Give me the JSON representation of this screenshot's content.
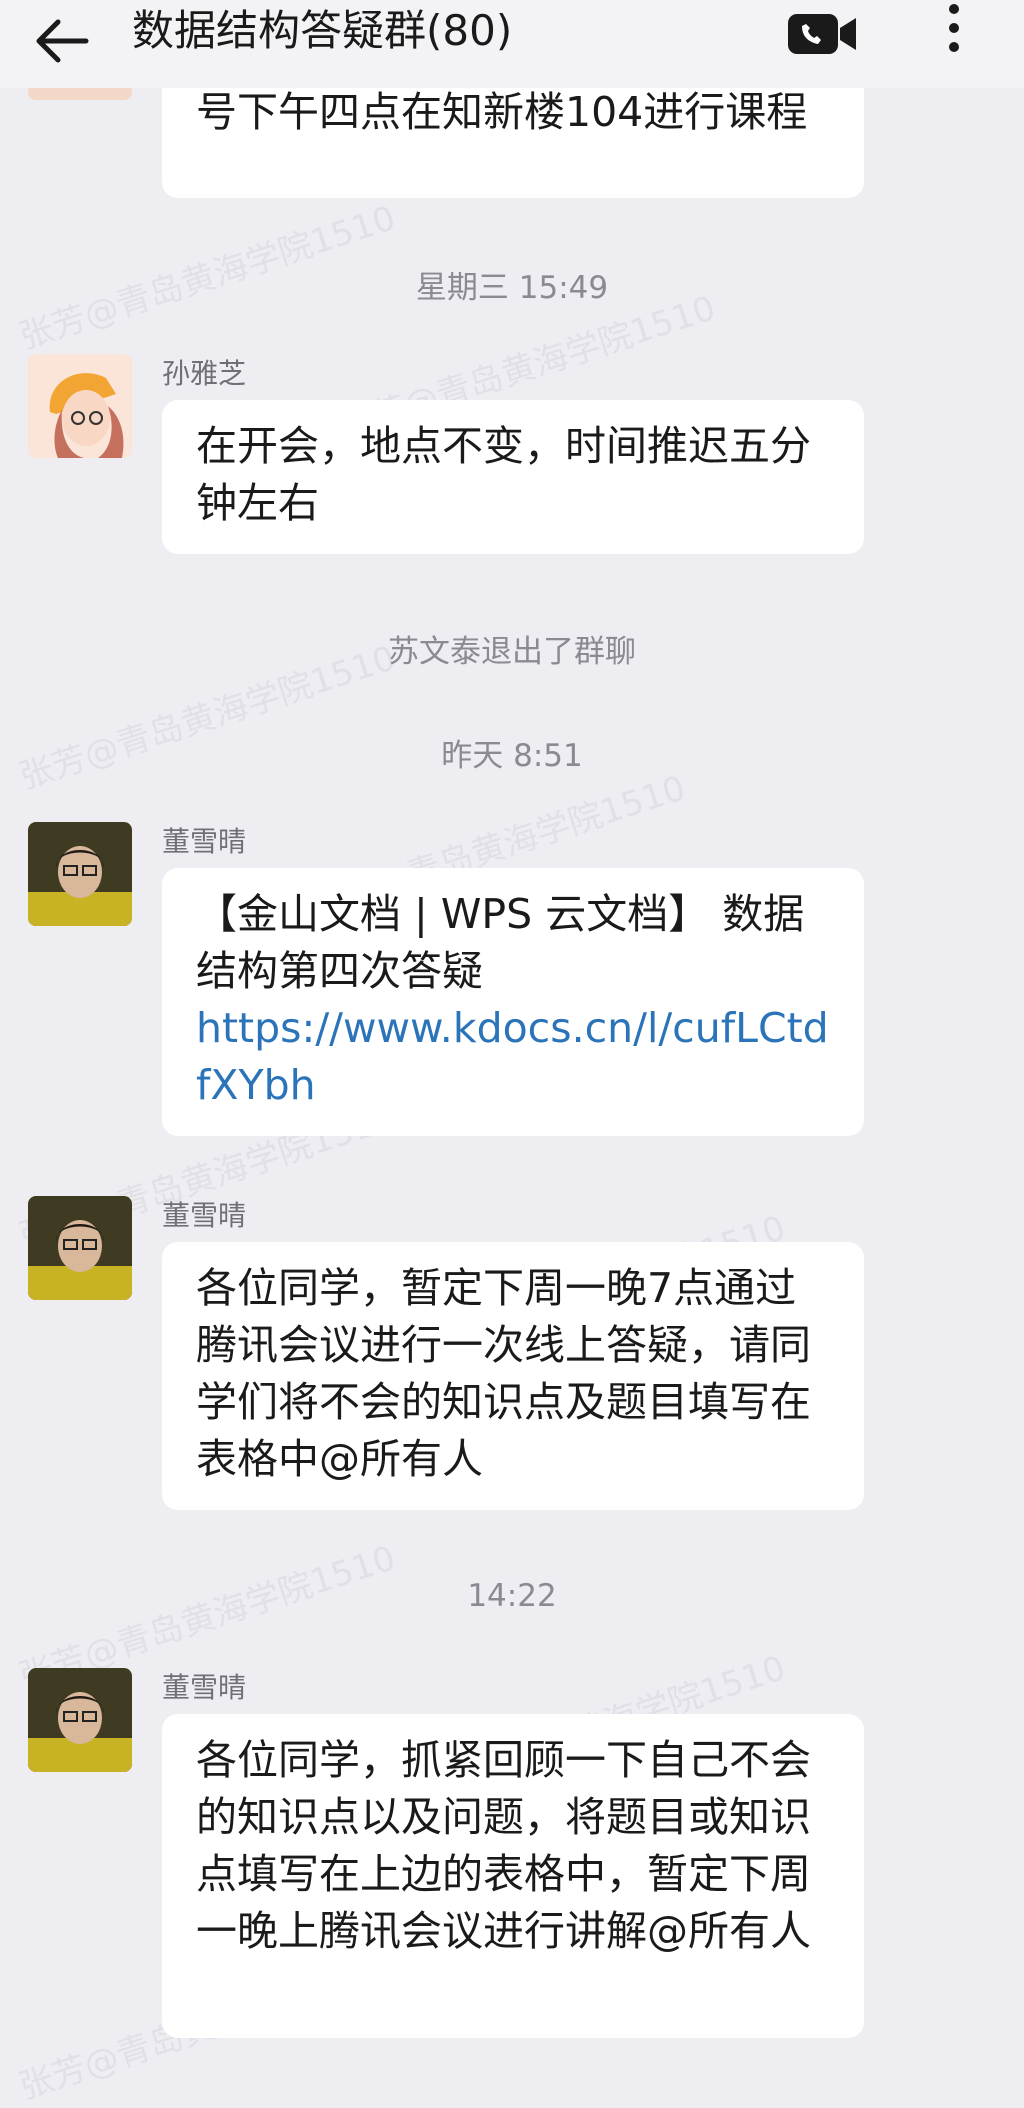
{
  "header": {
    "title": "数据结构答疑群(80)",
    "back_icon": "arrow-left-icon",
    "video_icon": "video-call-icon",
    "more_icon": "more-vertical-icon"
  },
  "watermark": "张芳@青岛黄海学院1510",
  "messages": {
    "m0_text": "号下午四点在知新楼104进行课程",
    "t1": "星期三  15:49",
    "m1_sender": "孙雅芝",
    "m1_text": "在开会，地点不变，时间推迟五分钟左右",
    "notice": "苏文泰退出了群聊",
    "t2": "昨天  8:51",
    "m2_sender": "董雪晴",
    "m2_text": "【金山文档 | WPS 云文档】 数据结构第四次答疑",
    "m2_link": "https://www.kdocs.cn/l/cufLCtdfXYbh",
    "m3_sender": "董雪晴",
    "m3_text": "各位同学，暂定下周一晚7点通过腾讯会议进行一次线上答疑，请同学们将不会的知识点及题目填写在表格中@所有人",
    "t3": "14:22",
    "m4_sender": "董雪晴",
    "m4_text": "各位同学，抓紧回顾一下自己不会的知识点以及问题，将题目或知识点填写在上边的表格中，暂定下周一晚上腾讯会议进行讲解@所有人"
  },
  "colors": {
    "background": "#ededf2",
    "bubble": "#ffffff",
    "link": "#2b74b9"
  }
}
